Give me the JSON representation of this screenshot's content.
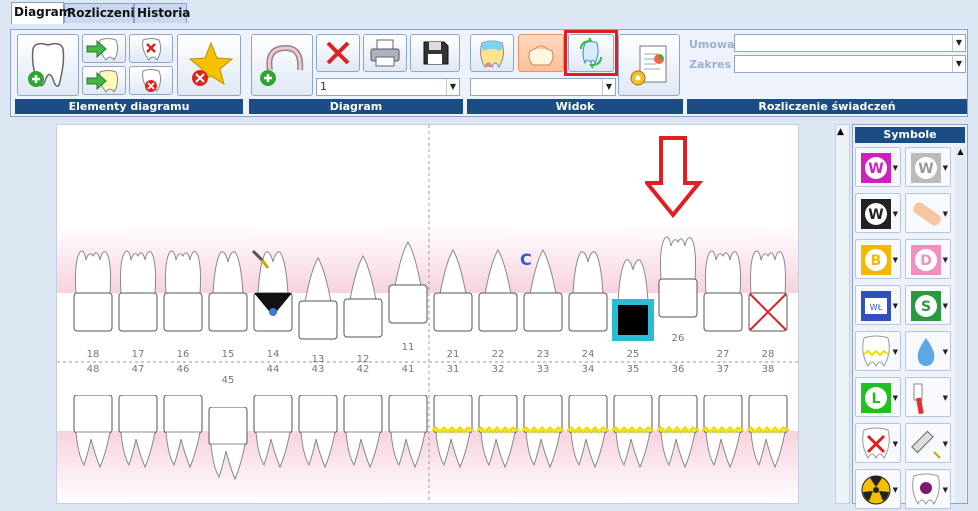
{
  "tabs": [
    {
      "label": "Diagram",
      "key": "D",
      "active": true
    },
    {
      "label": "Rozliczenia",
      "key": "R",
      "active": false
    },
    {
      "label": "Historia",
      "key": "H",
      "active": false
    }
  ],
  "ribbon": {
    "groups": {
      "elementy": "Elementy diagramu",
      "diagram": "Diagram",
      "widok": "Widok",
      "rozliczenie": "Rozliczenie świadczeń"
    },
    "diagram_select": "1",
    "widok_select": "",
    "umowa_label": "Umowa",
    "zakres_label": "Zakres",
    "umowa_value": "",
    "zakres_value": ""
  },
  "teeth": {
    "upper_numbers": [
      "18",
      "17",
      "16",
      "15",
      "14",
      "13",
      "12",
      "11",
      "21",
      "22",
      "23",
      "24",
      "25",
      "26",
      "27",
      "28"
    ],
    "lower_numbers": [
      "48",
      "47",
      "46",
      "45",
      "44",
      "43",
      "42",
      "41",
      "31",
      "32",
      "33",
      "34",
      "35",
      "36",
      "37",
      "38"
    ],
    "annotation_c": "C"
  },
  "symbols": {
    "title": "Symbole",
    "items": [
      "symbol-w-magenta",
      "symbol-w-gray",
      "symbol-w-black",
      "symbol-bandage",
      "symbol-b-orange",
      "symbol-d-pink",
      "symbol-wb-pattern",
      "symbol-s-green",
      "symbol-tooth-yellow",
      "symbol-drop-blue",
      "symbol-l-green",
      "symbol-toothbrush",
      "symbol-tooth-x",
      "symbol-syringe",
      "symbol-radiation",
      "symbol-skull-tooth"
    ]
  }
}
